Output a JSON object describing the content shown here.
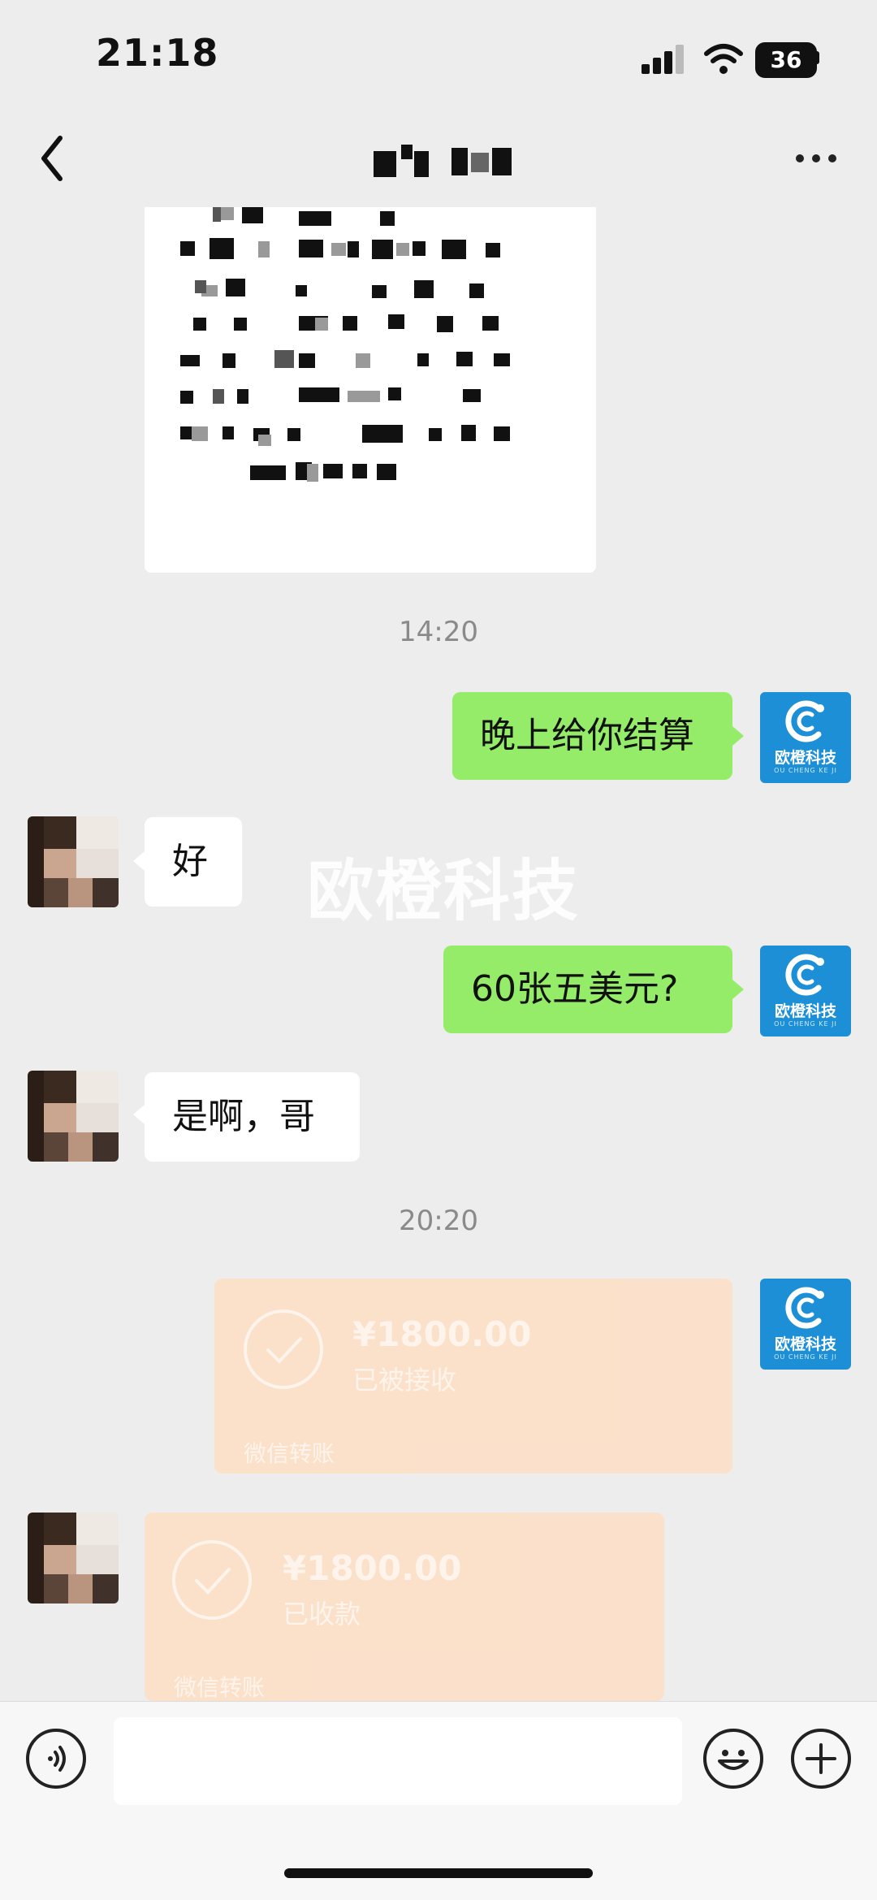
{
  "status_bar": {
    "time": "21:18",
    "battery": "36"
  },
  "header": {
    "back_icon": "chevron-left-icon",
    "more_icon": "more-dots-icon"
  },
  "watermark": "欧橙科技",
  "brand_avatar": {
    "name": "欧橙科技",
    "subtitle": "OU CHENG KE JI",
    "color": "#1c8fd6"
  },
  "timestamps": [
    "14:20",
    "20:20"
  ],
  "messages": [
    {
      "from": "me",
      "text": "晚上给你结算"
    },
    {
      "from": "other",
      "text": "好"
    },
    {
      "from": "me",
      "text": "60张五美元?"
    },
    {
      "from": "other",
      "text": "是啊，哥"
    }
  ],
  "transfers": [
    {
      "from": "me",
      "amount": "¥1800.00",
      "status": "已被接收",
      "footer": "微信转账"
    },
    {
      "from": "other",
      "amount": "¥1800.00",
      "status": "已收款",
      "footer": "微信转账"
    }
  ],
  "input_bar": {
    "placeholder": ""
  },
  "colors": {
    "my_bubble": "#95ec69",
    "other_bubble": "#ffffff",
    "transfer_card": "#fce0c9",
    "background": "#ededed"
  }
}
